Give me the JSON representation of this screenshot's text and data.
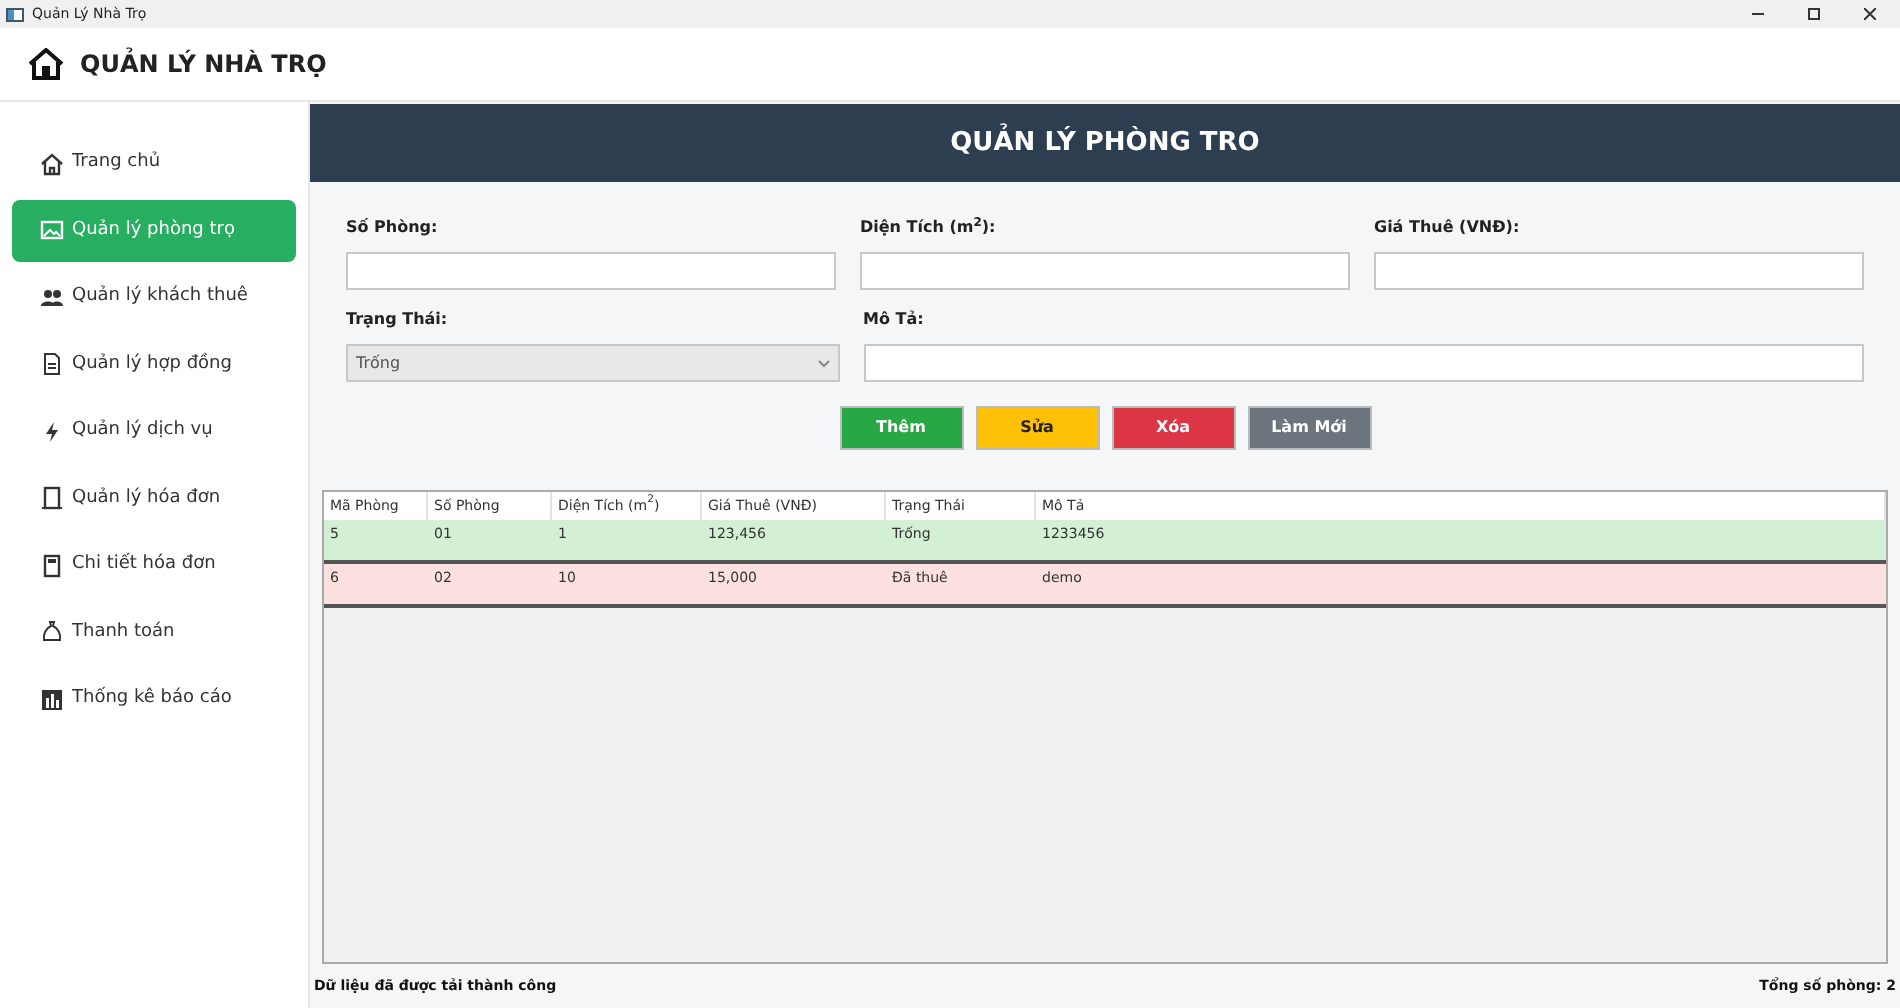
{
  "window": {
    "title": "Quản Lý Nhà Trọ"
  },
  "app_title": "QUẢN LÝ NHÀ TRỌ",
  "sidebar": {
    "items": [
      {
        "label": "Trang chủ",
        "selected": false
      },
      {
        "label": "Quản lý phòng trọ",
        "selected": true
      },
      {
        "label": "Quản lý khách thuê",
        "selected": false
      },
      {
        "label": "Quản lý hợp đồng",
        "selected": false
      },
      {
        "label": "Quản lý dịch vụ",
        "selected": false
      },
      {
        "label": "Quản lý hóa đơn",
        "selected": false
      },
      {
        "label": "Chi tiết hóa đơn",
        "selected": false
      },
      {
        "label": "Thanh toán",
        "selected": false
      },
      {
        "label": "Thống kê báo cáo",
        "selected": false
      }
    ]
  },
  "page_title": "QUẢN LÝ PHÒNG TRO",
  "form": {
    "fields": [
      {
        "label": "Số Phòng:",
        "kind": "text"
      },
      {
        "label": "Diện Tích (m$^{2}$):",
        "kind": "text"
      },
      {
        "label": "Giá Thuê (VNĐ):",
        "kind": "text"
      },
      {
        "label": "Trạng Thái:",
        "kind": "select",
        "value": "Trống"
      },
      {
        "label": "Mô Tả:",
        "kind": "text"
      }
    ]
  },
  "buttons": [
    {
      "label": "Thêm",
      "color": "#28a745"
    },
    {
      "label": "Sửa",
      "color": "#ffc107"
    },
    {
      "label": "Xóa",
      "color": "#dc3545"
    },
    {
      "label": "Làm Mới",
      "color": "#6c757d"
    }
  ],
  "table": {
    "columns": [
      "Mã Phòng",
      "Số Phòng",
      "Diện Tích (m$^{2}$)",
      "Giá Thuê (VNĐ)",
      "Trạng Thái",
      "Mô Tả"
    ],
    "rows": [
      {
        "cells": [
          "5",
          "01",
          "1",
          "123,456",
          "Trống",
          "1233456"
        ],
        "color": "#d4f0d4"
      },
      {
        "cells": [
          "6",
          "02",
          "10",
          "15,000",
          "Đã thuê",
          "demo"
        ],
        "color": "#fde0e0"
      }
    ]
  },
  "status_bar": {
    "message": "Dữ liệu đã được tải thành công",
    "count": "Tổng số phòng: 2"
  }
}
